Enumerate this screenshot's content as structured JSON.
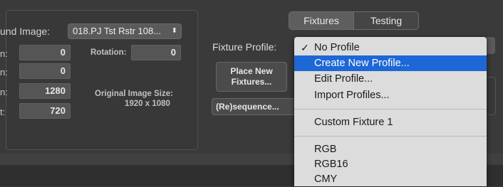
{
  "background_image": {
    "label": "und Image:",
    "file_value": "018.PJ Tst Rstr 108...",
    "stepper_icon": "up-down-arrows"
  },
  "fields": {
    "row1_label": "n:",
    "row1_value": "0",
    "row2_label": "n:",
    "row2_value": "0",
    "row3_label": "n:",
    "row3_value": "1280",
    "row4_label": "t:",
    "row4_value": "720"
  },
  "rotation": {
    "label": "Rotation:",
    "value": "0"
  },
  "original_size": {
    "label": "Original Image Size:",
    "value": "1920 x 1080"
  },
  "tabs": [
    {
      "label": "Fixtures"
    },
    {
      "label": "Testing"
    }
  ],
  "fixture_profile": {
    "label": "Fixture Profile:"
  },
  "buttons": {
    "place_new_fixtures": "Place New\nFixtures...",
    "resequence": "(Re)sequence..."
  },
  "menu": {
    "check_glyph": "✓",
    "items": [
      {
        "label": "No Profile",
        "checked": true
      },
      {
        "label": "Create New Profile...",
        "highlighted": true
      },
      {
        "label": "Edit Profile..."
      },
      {
        "label": "Import Profiles..."
      },
      {
        "label": "Custom Fixture 1"
      },
      {
        "label": "RGB"
      },
      {
        "label": "RGB16"
      },
      {
        "label": "CMY"
      }
    ]
  },
  "colors": {
    "background": "#3a3a3a",
    "menu_background": "#dcdcdc",
    "menu_highlight": "#1d67d6"
  }
}
